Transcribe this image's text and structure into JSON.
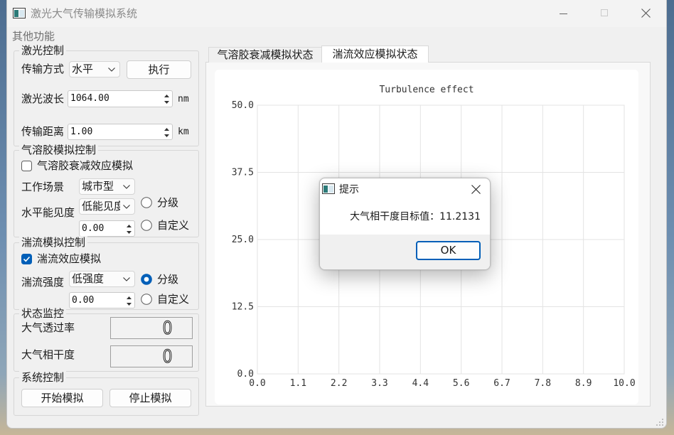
{
  "window": {
    "title": "激光大气传输模拟系统",
    "maximize_enabled": false
  },
  "menubar": {
    "items": [
      {
        "label": "其他功能"
      }
    ]
  },
  "laser_control": {
    "title": "激光控制",
    "mode_label": "传输方式",
    "mode_value": "水平",
    "execute_label": "执行",
    "wavelength_label": "激光波长",
    "wavelength_value": "1064.00",
    "wavelength_unit": "nm",
    "distance_label": "传输距离",
    "distance_value": "1.00",
    "distance_unit": "km"
  },
  "aerosol_control": {
    "title": "气溶胶模拟控制",
    "enable_label": "气溶胶衰减效应模拟",
    "enable_checked": false,
    "scene_label": "工作场景",
    "scene_value": "城市型",
    "visibility_label": "水平能见度",
    "visibility_value": "低能见度",
    "visibility_custom_value": "0.00",
    "graded_label": "分级",
    "graded_checked": false,
    "custom_label": "自定义",
    "custom_checked": false
  },
  "turbulence_control": {
    "title": "湍流模拟控制",
    "enable_label": "湍流效应模拟",
    "enable_checked": true,
    "strength_label": "湍流强度",
    "strength_value": "低强度",
    "strength_custom_value": "0.00",
    "graded_label": "分级",
    "graded_checked": true,
    "custom_label": "自定义",
    "custom_checked": false
  },
  "status_monitor": {
    "title": "状态监控",
    "transmittance_label": "大气透过率",
    "transmittance_value": "0",
    "coherence_label": "大气相干度",
    "coherence_value": "0"
  },
  "system_control": {
    "title": "系统控制",
    "start_label": "开始模拟",
    "stop_label": "停止模拟"
  },
  "tabs": [
    {
      "label": "气溶胶衰减模拟状态",
      "active": false
    },
    {
      "label": "湍流效应模拟状态",
      "active": true
    }
  ],
  "chart_data": {
    "type": "line",
    "title": "Turbulence effect",
    "xlim": [
      0,
      10
    ],
    "ylim": [
      0,
      50
    ],
    "x_tick_labels": [
      "0.0",
      "1.1",
      "2.2",
      "3.3",
      "4.4",
      "5.6",
      "6.7",
      "7.8",
      "8.9",
      "10.0"
    ],
    "y_tick_labels": [
      "0.0",
      "12.5",
      "25.0",
      "37.5",
      "50.0"
    ],
    "grid": true,
    "series": []
  },
  "dialog": {
    "title": "提示",
    "message": "大气相干度目标值：11.2131",
    "ok_label": "OK"
  },
  "icons": {
    "app": "app-window-icon",
    "minimize": "minimize-icon",
    "maximize": "maximize-icon",
    "close": "close-icon",
    "dropdown": "chevron-down-icon",
    "spin_up": "spin-up-icon",
    "spin_down": "spin-down-icon",
    "size_grip": "size-grip-icon"
  },
  "colors": {
    "accent": "#005fb8",
    "window_bg": "#f0f0f0",
    "chart_grid": "#e3e3e3",
    "chart_bg": "#ffffff"
  }
}
